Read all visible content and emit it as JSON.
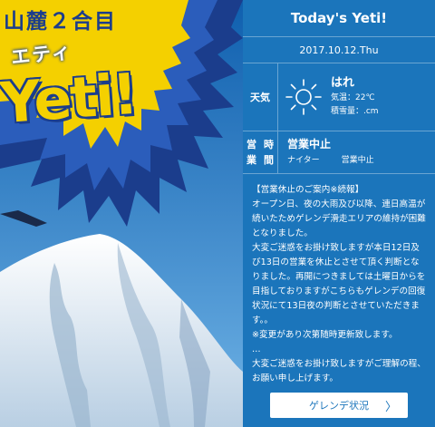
{
  "hero": {
    "title": "山麓２合目",
    "katakana": "エティ",
    "logo": "Yeti!"
  },
  "panel": {
    "title": "Today's Yeti!",
    "date": "2017.10.12.Thu",
    "weather": {
      "label": "天気",
      "condition": "はれ",
      "temp": "気温：22℃",
      "snow": "積雪量：.cm",
      "icon": "sun-icon"
    },
    "hours": {
      "label_1": "営業",
      "label_2": "時間",
      "status": "営業中止",
      "night_label": "ナイター",
      "night_status": "営業中止"
    },
    "notice": [
      "【営業休止のご案内※続報】",
      "オープン日、夜の大雨及び以降、連日高温が続いたためゲレンデ滑走エリアの維持が困難となりました。",
      "大変ご迷惑をお掛け致しますが本日12日及び13日の営業を休止とさせて頂く判断となりました。再開につきましては土曜日からを目指しておりますがこちらもゲレンデの回復状況にて13日夜の判断とさせていただきます。。",
      "※変更があり次第随時更新致します。",
      "…",
      "大変ご迷惑をお掛け致しますがご理解の程、お願い申し上げます。"
    ],
    "button_label": "ゲレンデ状況",
    "button_chevron": "〉"
  },
  "colors": {
    "panel_bg": "#1b75bb",
    "sky": "#1a6fb8",
    "burst": "#1b3d8c",
    "logo_yellow": "#f4d000"
  }
}
